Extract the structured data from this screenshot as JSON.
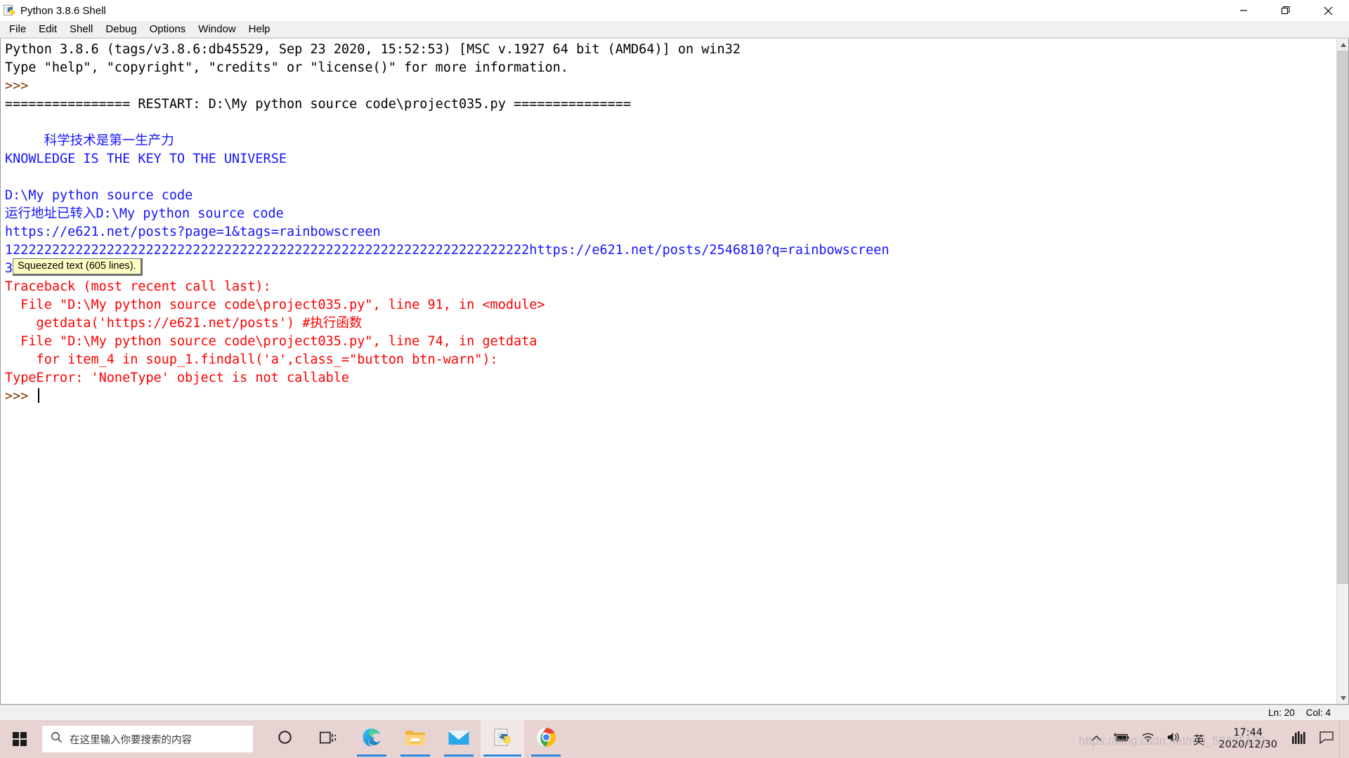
{
  "window": {
    "title": "Python 3.8.6 Shell",
    "icon": "python-file-icon",
    "controls": {
      "minimize": "minimize-icon",
      "maximize": "restore-icon",
      "close": "close-icon"
    }
  },
  "menu": {
    "items": [
      {
        "label": "File"
      },
      {
        "label": "Edit"
      },
      {
        "label": "Shell"
      },
      {
        "label": "Debug"
      },
      {
        "label": "Options"
      },
      {
        "label": "Window"
      },
      {
        "label": "Help"
      }
    ]
  },
  "shell": {
    "lines": [
      {
        "id": "l1",
        "color": "black",
        "text": "Python 3.8.6 (tags/v3.8.6:db45529, Sep 23 2020, 15:52:53) [MSC v.1927 64 bit (AMD64)] on win32"
      },
      {
        "id": "l2",
        "color": "black",
        "text": "Type \"help\", \"copyright\", \"credits\" or \"license()\" for more information."
      },
      {
        "id": "l3",
        "color": "brown",
        "text": ">>> "
      },
      {
        "id": "l4",
        "color": "black",
        "text": "================ RESTART: D:\\My python source code\\project035.py ==============="
      },
      {
        "id": "l5",
        "color": "black",
        "text": ""
      },
      {
        "id": "l6",
        "color": "blue",
        "text": "     科学技术是第一生产力"
      },
      {
        "id": "l7",
        "color": "blue",
        "text": "KNOWLEDGE IS THE KEY TO THE UNIVERSE"
      },
      {
        "id": "l8",
        "color": "blue",
        "text": ""
      },
      {
        "id": "l9",
        "color": "blue",
        "text": "D:\\My python source code"
      },
      {
        "id": "l10",
        "color": "blue",
        "text": "运行地址已转入D:\\My python source code"
      },
      {
        "id": "l11",
        "color": "blue",
        "text": "https://e621.net/posts?page=1&tags=rainbowscreen"
      },
      {
        "id": "l12",
        "color": "blue",
        "text": "1222222222222222222222222222222222222222222222222222222222222222222https://e621.net/posts/2546810?q=rainbowscreen"
      },
      {
        "id": "l13",
        "color": "blue",
        "text": "3",
        "squeezed": "Squeezed text (605 lines)."
      },
      {
        "id": "l14",
        "color": "red",
        "text": "Traceback (most recent call last):"
      },
      {
        "id": "l15",
        "color": "red",
        "text": "  File \"D:\\My python source code\\project035.py\", line 91, in <module>"
      },
      {
        "id": "l16",
        "color": "red",
        "text": "    getdata('https://e621.net/posts') #执行函数"
      },
      {
        "id": "l17",
        "color": "red",
        "text": "  File \"D:\\My python source code\\project035.py\", line 74, in getdata"
      },
      {
        "id": "l18",
        "color": "red",
        "text": "    for item_4 in soup_1.findall('a',class_=\"button btn-warn\"):"
      },
      {
        "id": "l19",
        "color": "red",
        "text": "TypeError: 'NoneType' object is not callable"
      },
      {
        "id": "l20",
        "color": "brown",
        "text": ">>> ",
        "caret": true
      }
    ]
  },
  "status": {
    "line": "Ln: 20",
    "column": "Col: 4"
  },
  "taskbar": {
    "start": "windows-logo-icon",
    "search": {
      "icon": "search-icon",
      "placeholder": "在这里输入你要搜索的内容"
    },
    "items": [
      {
        "name": "cortana",
        "icon": "cortana-circle-icon",
        "active": false,
        "running": false
      },
      {
        "name": "task-view",
        "icon": "task-view-icon",
        "active": false,
        "running": false
      },
      {
        "name": "microsoft-edge",
        "icon": "edge-icon",
        "active": false,
        "running": true
      },
      {
        "name": "file-explorer",
        "icon": "folder-icon",
        "active": false,
        "running": true
      },
      {
        "name": "mail",
        "icon": "mail-icon",
        "active": false,
        "running": true
      },
      {
        "name": "python-idle",
        "icon": "python-file-icon",
        "active": true,
        "running": true
      },
      {
        "name": "google-chrome",
        "icon": "chrome-icon",
        "active": false,
        "running": true
      }
    ],
    "tray": {
      "chevron": "chevron-up-icon",
      "battery": "battery-charging-icon",
      "network": "wifi-icon",
      "volume": "speaker-icon",
      "ime": "英",
      "clock": {
        "time": "17:44",
        "date": "2020/12/30"
      },
      "extra": "monitor-graph-icon",
      "action_center": "action-center-icon",
      "watermark": "https://blog.csdn.net/m0_52285139"
    }
  }
}
